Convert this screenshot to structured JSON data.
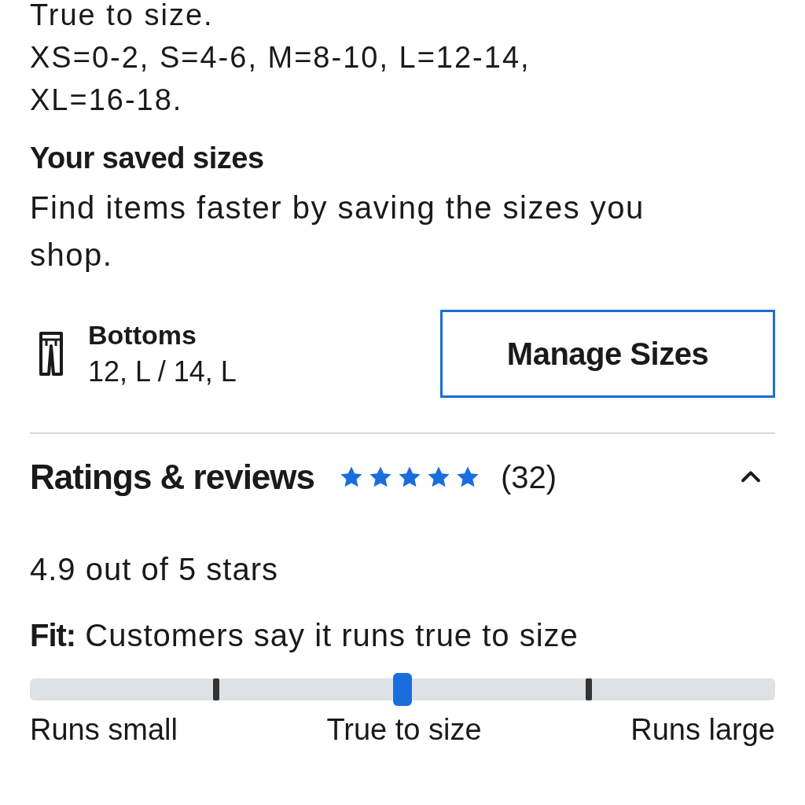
{
  "size_guide": {
    "lines": [
      "True to size.",
      "XS=0-2, S=4-6, M=8-10, L=12-14, XL=16-18."
    ]
  },
  "saved_sizes": {
    "title": "Your saved sizes",
    "description": "Find items faster by saving the sizes you shop.",
    "category": {
      "name": "Bottoms",
      "sizes": "12, L / 14, L"
    },
    "button": "Manage Sizes"
  },
  "ratings": {
    "title": "Ratings & reviews",
    "stars": 5,
    "count": "(32)",
    "expanded": true,
    "summary": "4.9 out of 5 stars",
    "fit": {
      "label": "Fit:",
      "text": "Customers say it runs true to size",
      "level": 0.5,
      "scale_labels": [
        "Runs small",
        "True to size",
        "Runs large"
      ]
    }
  }
}
